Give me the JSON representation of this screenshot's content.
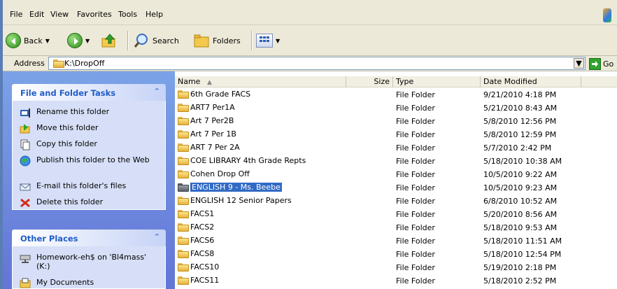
{
  "menu": [
    "File",
    "Edit",
    "View",
    "Favorites",
    "Tools",
    "Help"
  ],
  "toolbar": {
    "back_label": "Back",
    "search_label": "Search",
    "folders_label": "Folders"
  },
  "address": {
    "label": "Address",
    "value": "K:\\DropOff",
    "go_label": "Go"
  },
  "tasks_panel": {
    "title": "File and Folder Tasks",
    "items": [
      {
        "label": "Rename this folder",
        "icon": "rename-icon"
      },
      {
        "label": "Move this folder",
        "icon": "move-icon"
      },
      {
        "label": "Copy this folder",
        "icon": "copy-icon"
      },
      {
        "label": "Publish this folder to the Web",
        "icon": "publish-icon"
      },
      {
        "label": "E-mail this folder's files",
        "icon": "email-icon"
      },
      {
        "label": "Delete this folder",
        "icon": "delete-icon"
      }
    ]
  },
  "places_panel": {
    "title": "Other Places",
    "items": [
      {
        "label": "Homework-eh$ on 'Bl4mass' (K:)",
        "icon": "network-drive-icon"
      },
      {
        "label": "My Documents",
        "icon": "my-documents-icon"
      }
    ]
  },
  "columns": {
    "name": "Name",
    "size": "Size",
    "type": "Type",
    "date": "Date Modified"
  },
  "files": [
    {
      "name": "6th Grade FACS",
      "type": "File Folder",
      "date": "9/21/2010 4:18 PM"
    },
    {
      "name": "ART7 Per1A",
      "type": "File Folder",
      "date": "5/21/2010 8:43 AM"
    },
    {
      "name": "Art 7 Per2B",
      "type": "File Folder",
      "date": "5/8/2010 12:56 PM"
    },
    {
      "name": "Art 7 Per 1B",
      "type": "File Folder",
      "date": "5/8/2010 12:59 PM"
    },
    {
      "name": "ART 7 Per 2A",
      "type": "File Folder",
      "date": "5/7/2010 2:42 PM"
    },
    {
      "name": "COE LIBRARY 4th Grade Repts",
      "type": "File Folder",
      "date": "5/18/2010 10:38 AM"
    },
    {
      "name": "Cohen Drop Off",
      "type": "File Folder",
      "date": "10/5/2010 9:22 AM"
    },
    {
      "name": "ENGLISH 9 - Ms. Beebe",
      "type": "File Folder",
      "date": "10/5/2010 9:23 AM",
      "selected": true
    },
    {
      "name": "ENGLISH 12 Senior Papers",
      "type": "File Folder",
      "date": "6/8/2010 10:52 AM"
    },
    {
      "name": "FACS1",
      "type": "File Folder",
      "date": "5/20/2010 8:56 AM"
    },
    {
      "name": "FACS2",
      "type": "File Folder",
      "date": "5/18/2010 9:53 AM"
    },
    {
      "name": "FACS6",
      "type": "File Folder",
      "date": "5/18/2010 11:51 AM"
    },
    {
      "name": "FACS8",
      "type": "File Folder",
      "date": "5/18/2010 12:54 PM"
    },
    {
      "name": "FACS10",
      "type": "File Folder",
      "date": "5/19/2010 2:18 PM"
    },
    {
      "name": "FACS11",
      "type": "File Folder",
      "date": "5/18/2010 2:52 PM"
    }
  ]
}
